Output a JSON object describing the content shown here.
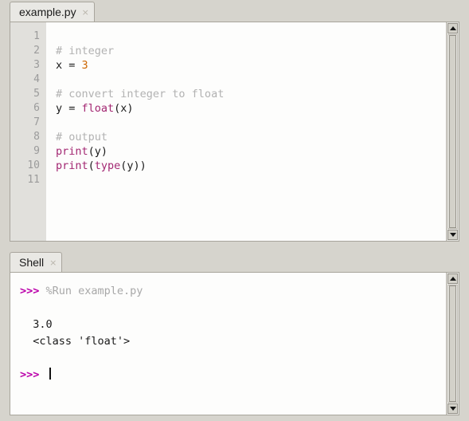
{
  "app": {
    "name": "Thonny",
    "background_color": "#d6d4cd"
  },
  "editor": {
    "tab": {
      "label": "example.py",
      "close_icon": "×"
    },
    "line_numbers": [
      "1",
      "2",
      "3",
      "4",
      "5",
      "6",
      "7",
      "8",
      "9",
      "10",
      "11"
    ],
    "lines": [
      {
        "number": "1",
        "tokens": []
      },
      {
        "number": "2",
        "tokens": [
          {
            "text": "# integer",
            "type": "comment"
          }
        ]
      },
      {
        "number": "3",
        "tokens": [
          {
            "text": "x = ",
            "type": "plain"
          },
          {
            "text": "3",
            "type": "number"
          }
        ]
      },
      {
        "number": "4",
        "tokens": []
      },
      {
        "number": "5",
        "tokens": [
          {
            "text": "# convert integer to float",
            "type": "comment"
          }
        ]
      },
      {
        "number": "6",
        "tokens": [
          {
            "text": "y = ",
            "type": "plain"
          },
          {
            "text": "float",
            "type": "builtin"
          },
          {
            "text": "(x)",
            "type": "plain"
          }
        ]
      },
      {
        "number": "7",
        "tokens": []
      },
      {
        "number": "8",
        "tokens": [
          {
            "text": "# output",
            "type": "comment"
          }
        ]
      },
      {
        "number": "9",
        "tokens": [
          {
            "text": "print",
            "type": "builtin"
          },
          {
            "text": "(y)",
            "type": "plain"
          }
        ]
      },
      {
        "number": "10",
        "tokens": [
          {
            "text": "print",
            "type": "builtin"
          },
          {
            "text": "(",
            "type": "plain"
          },
          {
            "text": "type",
            "type": "builtin"
          },
          {
            "text": "(y))",
            "type": "plain"
          }
        ]
      },
      {
        "number": "11",
        "tokens": []
      }
    ],
    "scrollbar": {
      "up_icon": "scroll-up-arrow",
      "down_icon": "scroll-down-arrow",
      "thumb_top_pct": 0,
      "thumb_height_pct": 100
    }
  },
  "shell": {
    "tab": {
      "label": "Shell",
      "close_icon": "×"
    },
    "lines": [
      {
        "segments": [
          {
            "text": ">>> ",
            "type": "prompt"
          },
          {
            "text": "%Run example.py",
            "type": "command"
          }
        ]
      },
      {
        "segments": []
      },
      {
        "segments": [
          {
            "text": "  3.0",
            "type": "output"
          }
        ]
      },
      {
        "segments": [
          {
            "text": "  <class 'float'>",
            "type": "output"
          }
        ]
      },
      {
        "segments": []
      },
      {
        "segments": [
          {
            "text": ">>> ",
            "type": "prompt"
          }
        ],
        "caret": true
      }
    ],
    "scrollbar": {
      "up_icon": "scroll-up-arrow",
      "down_icon": "scroll-down-arrow",
      "thumb_top_pct": 0,
      "thumb_height_pct": 100
    }
  },
  "colors": {
    "comment": "#b2b2b2",
    "builtin": "#a32772",
    "number": "#cc6600",
    "plain": "#1a1a1a",
    "prompt": "#bb00aa",
    "command": "#a8a8a8"
  }
}
